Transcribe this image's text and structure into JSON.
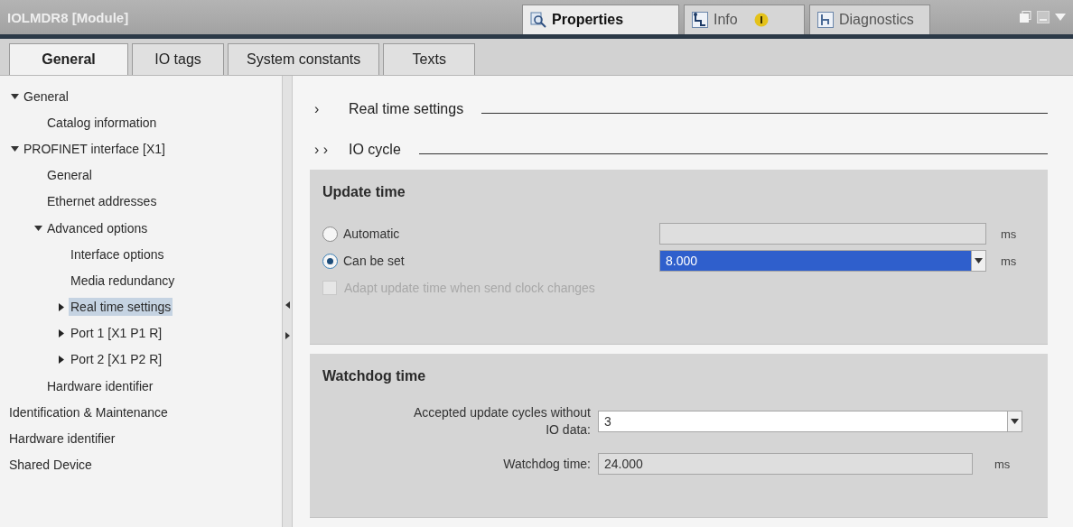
{
  "window": {
    "title": "IOLMDR8 [Module]"
  },
  "inspector_tabs": [
    {
      "label": "Properties",
      "kind": "properties",
      "selected": true
    },
    {
      "label": "Info",
      "kind": "info",
      "selected": false
    },
    {
      "label": "Diagnostics",
      "kind": "diagnostics",
      "selected": false
    }
  ],
  "tabs": [
    {
      "label": "General",
      "selected": true
    },
    {
      "label": "IO tags",
      "selected": false
    },
    {
      "label": "System constants",
      "selected": false
    },
    {
      "label": "Texts",
      "selected": false
    }
  ],
  "tree": [
    {
      "label": "General",
      "expanded": true,
      "selected": false,
      "children": [
        {
          "label": "Catalog information",
          "selected": false
        }
      ]
    },
    {
      "label": "PROFINET interface [X1]",
      "expanded": true,
      "selected": false,
      "children": [
        {
          "label": "General",
          "selected": false
        },
        {
          "label": "Ethernet addresses",
          "selected": false
        },
        {
          "label": "Advanced options",
          "expanded": true,
          "selected": false,
          "children": [
            {
              "label": "Interface options",
              "selected": false
            },
            {
              "label": "Media redundancy",
              "selected": false
            },
            {
              "label": "Real time settings",
              "expanded": false,
              "selected": true
            },
            {
              "label": "Port 1 [X1 P1 R]",
              "expanded": false,
              "selected": false
            },
            {
              "label": "Port 2 [X1 P2 R]",
              "expanded": false,
              "selected": false
            }
          ]
        },
        {
          "label": "Hardware identifier",
          "selected": false
        }
      ]
    },
    {
      "label": "Identification & Maintenance",
      "selected": false
    },
    {
      "label": "Hardware identifier",
      "selected": false
    },
    {
      "label": "Shared Device",
      "selected": false
    }
  ],
  "headings": [
    {
      "marker": "›",
      "title": "Real time settings"
    },
    {
      "marker": "› ›",
      "title": "IO cycle"
    }
  ],
  "update_time": {
    "title": "Update time",
    "options": [
      {
        "label": "Automatic",
        "selected": false,
        "field": {
          "kind": "readonly"
        },
        "unit": "ms"
      },
      {
        "label": "Can be set",
        "selected": true,
        "field": {
          "kind": "dropdown",
          "value": "8.000"
        },
        "unit": "ms"
      }
    ],
    "checkbox": {
      "label": "Adapt update time when send clock changes",
      "checked": false,
      "disabled": true
    }
  },
  "watchdog": {
    "title": "Watchdog time",
    "rows": [
      {
        "label": "Accepted update cycles without IO data:",
        "kind": "dropdown",
        "value": "3"
      },
      {
        "label": "Watchdog time:",
        "kind": "readonly",
        "value": "24.000",
        "unit": "ms"
      }
    ]
  }
}
